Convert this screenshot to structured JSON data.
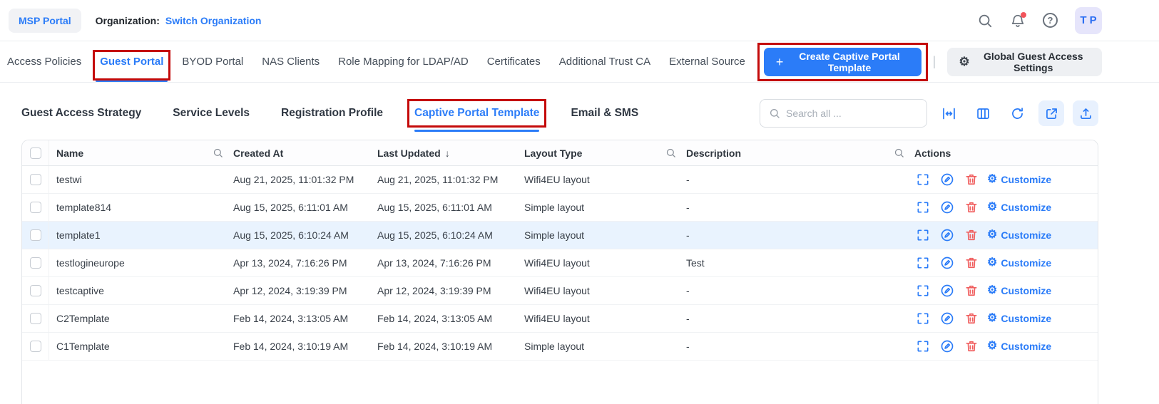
{
  "colors": {
    "accent_blue": "#2b7cf8",
    "annotation_red": "#c40a0a",
    "danger_red": "#f05f5f",
    "row_highlight": "#e9f3fe"
  },
  "icons": {
    "plus": "+",
    "gear": "⚙",
    "sort_desc": "↓",
    "help": "?"
  },
  "header": {
    "portal_badge": "MSP Portal",
    "organization_label": "Organization:",
    "organization_link": "Switch Organization",
    "avatar_initials": "T P"
  },
  "main_tabs": {
    "items": [
      {
        "label": "Access Policies"
      },
      {
        "label": "Guest Portal"
      },
      {
        "label": "BYOD Portal"
      },
      {
        "label": "NAS Clients"
      },
      {
        "label": "Role Mapping for LDAP/AD"
      },
      {
        "label": "Certificates"
      },
      {
        "label": "Additional Trust CA"
      },
      {
        "label": "External Source"
      }
    ],
    "active": "Guest Portal",
    "create_button": "Create Captive Portal Template",
    "divider": "|",
    "settings_button": "Global Guest Access Settings"
  },
  "sub_tabs": {
    "items": [
      "Guest Access Strategy",
      "Service Levels",
      "Registration Profile",
      "Captive Portal Template",
      "Email & SMS"
    ],
    "active": "Captive Portal Template",
    "search_placeholder": "Search all ..."
  },
  "table": {
    "headers": {
      "name": "Name",
      "created_at": "Created At",
      "last_updated": "Last Updated",
      "layout_type": "Layout Type",
      "description": "Description",
      "actions": "Actions"
    },
    "customize_label": "Customize",
    "rows": [
      {
        "name": "testwi",
        "created_at": "Aug 21, 2025, 11:01:32 PM",
        "last_updated": "Aug 21, 2025, 11:01:32 PM",
        "layout_type": "Wifi4EU layout",
        "description": "-"
      },
      {
        "name": "template814",
        "created_at": "Aug 15, 2025, 6:11:01 AM",
        "last_updated": "Aug 15, 2025, 6:11:01 AM",
        "layout_type": "Simple layout",
        "description": "-"
      },
      {
        "name": "template1",
        "created_at": "Aug 15, 2025, 6:10:24 AM",
        "last_updated": "Aug 15, 2025, 6:10:24 AM",
        "layout_type": "Simple layout",
        "description": "-"
      },
      {
        "name": "testlogineurope",
        "created_at": "Apr 13, 2024, 7:16:26 PM",
        "last_updated": "Apr 13, 2024, 7:16:26 PM",
        "layout_type": "Wifi4EU layout",
        "description": "Test"
      },
      {
        "name": "testcaptive",
        "created_at": "Apr 12, 2024, 3:19:39 PM",
        "last_updated": "Apr 12, 2024, 3:19:39 PM",
        "layout_type": "Wifi4EU layout",
        "description": "-"
      },
      {
        "name": "C2Template",
        "created_at": "Feb 14, 2024, 3:13:05 AM",
        "last_updated": "Feb 14, 2024, 3:13:05 AM",
        "layout_type": "Wifi4EU layout",
        "description": "-"
      },
      {
        "name": "C1Template",
        "created_at": "Feb 14, 2024, 3:10:19 AM",
        "last_updated": "Feb 14, 2024, 3:10:19 AM",
        "layout_type": "Simple layout",
        "description": "-"
      }
    ]
  }
}
